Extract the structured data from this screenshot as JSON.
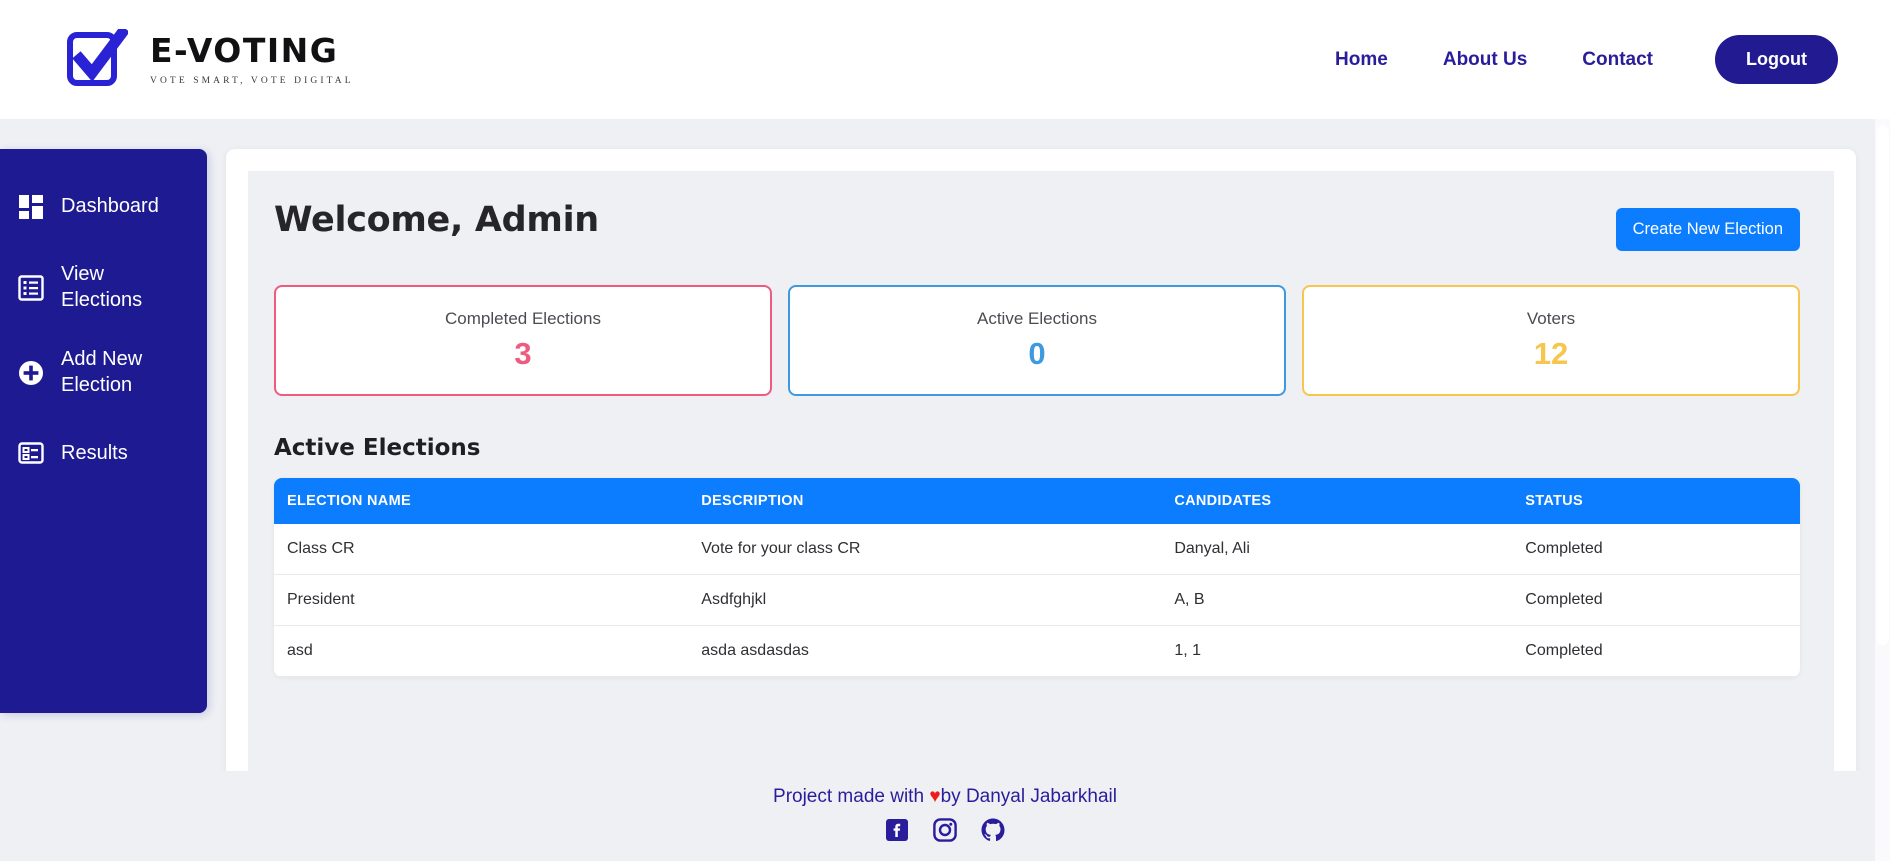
{
  "header": {
    "logo_icon": "checkbox-check-icon",
    "brand_name": "E-VOTING",
    "brand_tagline": "VOTE SMART, VOTE DIGITAL",
    "nav": [
      {
        "label": "Home"
      },
      {
        "label": "About Us"
      },
      {
        "label": "Contact"
      }
    ],
    "logout_label": "Logout"
  },
  "colors": {
    "brand_blue": "#221a91",
    "accent_blue": "#0b7dfe",
    "pink": "#ef5a7f",
    "sky": "#3d9ae0",
    "amber": "#f7c64f",
    "panel_bg": "#eef0f4",
    "heart_red": "#ef1c1c"
  },
  "sidebar": {
    "items": [
      {
        "label": "Dashboard",
        "icon": "grid-dashboard-icon"
      },
      {
        "label": "View Elections",
        "icon": "list-view-icon"
      },
      {
        "label": "Add New Election",
        "icon": "plus-circle-icon"
      },
      {
        "label": "Results",
        "icon": "results-list-icon"
      }
    ]
  },
  "main": {
    "page_title": "Welcome, Admin",
    "create_button": "Create New Election",
    "stats": [
      {
        "label": "Completed Elections",
        "value": "3",
        "color": "#ef5a7f"
      },
      {
        "label": "Active Elections",
        "value": "0",
        "color": "#3d9ae0"
      },
      {
        "label": "Voters",
        "value": "12",
        "color": "#f7c64f"
      }
    ],
    "table": {
      "section_title": "Active Elections",
      "columns": [
        "ELECTION NAME",
        "DESCRIPTION",
        "CANDIDATES",
        "STATUS"
      ],
      "rows": [
        {
          "name": "Class CR",
          "description": "Vote for your class CR",
          "candidates": "Danyal, Ali",
          "status": "Completed"
        },
        {
          "name": "President",
          "description": "Asdfghjkl",
          "candidates": "A, B",
          "status": "Completed"
        },
        {
          "name": "asd",
          "description": "asda asdasdas",
          "candidates": "1, 1",
          "status": "Completed"
        }
      ]
    }
  },
  "footer": {
    "text_before": "Project made with ",
    "heart": "♥",
    "text_after": "by Danyal Jabarkhail",
    "socials": [
      {
        "name": "facebook-icon"
      },
      {
        "name": "instagram-icon"
      },
      {
        "name": "github-icon"
      }
    ]
  }
}
